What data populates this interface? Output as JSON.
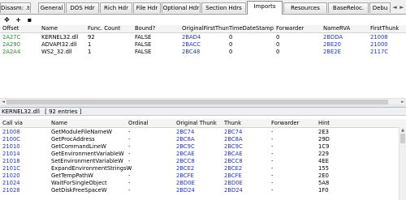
{
  "tabs": [
    {
      "label": "Disasm: .text"
    },
    {
      "label": "General"
    },
    {
      "label": "DOS Hdr"
    },
    {
      "label": "Rich Hdr"
    },
    {
      "label": "File Hdr"
    },
    {
      "label": "Optional Hdr"
    },
    {
      "label": "Section Hdrs"
    },
    {
      "label": "Imports"
    },
    {
      "label": "Resources"
    },
    {
      "label": "BaseReloc."
    },
    {
      "label": "Debu"
    }
  ],
  "active_tab": "Imports",
  "tab_nav": {
    "left": "◄",
    "right": "►"
  },
  "toolbar": {
    "move_glyph": "✥",
    "add_glyph": "+",
    "save_glyph": "▪"
  },
  "imports_table": {
    "headers": [
      "Offset",
      "Name",
      "Func. Count",
      "Bound?",
      "OriginalFirstThun",
      "TimeDateStamp",
      "Forwarder",
      "NameRVA",
      "FirstThunk"
    ],
    "rows": [
      {
        "offset": "2A27C",
        "name": "KERNEL32.dll",
        "count": "92",
        "bound": "FALSE",
        "oft": "2BAD4",
        "tds": "0",
        "fwd": "0",
        "namerva": "2BDDA",
        "ft": "21008"
      },
      {
        "offset": "2A290",
        "name": "ADVAPI32.dll",
        "count": "1",
        "bound": "FALSE",
        "oft": "2BACC",
        "tds": "0",
        "fwd": "0",
        "namerva": "2BE20",
        "ft": "21000"
      },
      {
        "offset": "2A2A4",
        "name": "WS2_32.dll",
        "count": "1",
        "bound": "FALSE",
        "oft": "2BC48",
        "tds": "0",
        "fwd": "0",
        "namerva": "2BE2E",
        "ft": "2117C"
      }
    ]
  },
  "scroll_arrows": {
    "left": "◄",
    "right": "►",
    "up": "▲",
    "down": "▼"
  },
  "caption": {
    "dll": "KERNEL32.dll",
    "entries": "[ 92 entries ]"
  },
  "functions_table": {
    "headers": [
      "Call via",
      "Name",
      "Ordinal",
      "Original Thunk",
      "Thunk",
      "Forwarder",
      "Hint"
    ],
    "rows": [
      {
        "callvia": "21008",
        "name": "GetModuleFileNameW",
        "ordinal": "-",
        "othunk": "2BC74",
        "thunk": "2BC74",
        "fwd": "-",
        "hint": "2E3"
      },
      {
        "callvia": "2100C",
        "name": "GetProcAddress",
        "ordinal": "-",
        "othunk": "2BC8A",
        "thunk": "2BC8A",
        "fwd": "-",
        "hint": "29D"
      },
      {
        "callvia": "21010",
        "name": "GetCommandLineW",
        "ordinal": "-",
        "othunk": "2BC9C",
        "thunk": "2BC9C",
        "fwd": "-",
        "hint": "1C9"
      },
      {
        "callvia": "21014",
        "name": "GetEnvironmentVariableW",
        "ordinal": "-",
        "othunk": "2BCAE",
        "thunk": "2BCAE",
        "fwd": "-",
        "hint": "229"
      },
      {
        "callvia": "21018",
        "name": "SetEnvironmentVariableW",
        "ordinal": "-",
        "othunk": "2BCC8",
        "thunk": "2BCC8",
        "fwd": "-",
        "hint": "4EE"
      },
      {
        "callvia": "2101C",
        "name": "ExpandEnvironmentStringsW",
        "ordinal": "-",
        "othunk": "2BCE2",
        "thunk": "2BCE2",
        "fwd": "-",
        "hint": "155"
      },
      {
        "callvia": "21020",
        "name": "GetTempPathW",
        "ordinal": "-",
        "othunk": "2BCFE",
        "thunk": "2BCFE",
        "fwd": "-",
        "hint": "2E0"
      },
      {
        "callvia": "21024",
        "name": "WaitForSingleObject",
        "ordinal": "-",
        "othunk": "2BD0E",
        "thunk": "2BD0E",
        "fwd": "-",
        "hint": "5A8"
      },
      {
        "callvia": "21028",
        "name": "GetDiskFreeSpaceW",
        "ordinal": "-",
        "othunk": "2BD24",
        "thunk": "2BD24",
        "fwd": "-",
        "hint": "1F0"
      }
    ]
  }
}
